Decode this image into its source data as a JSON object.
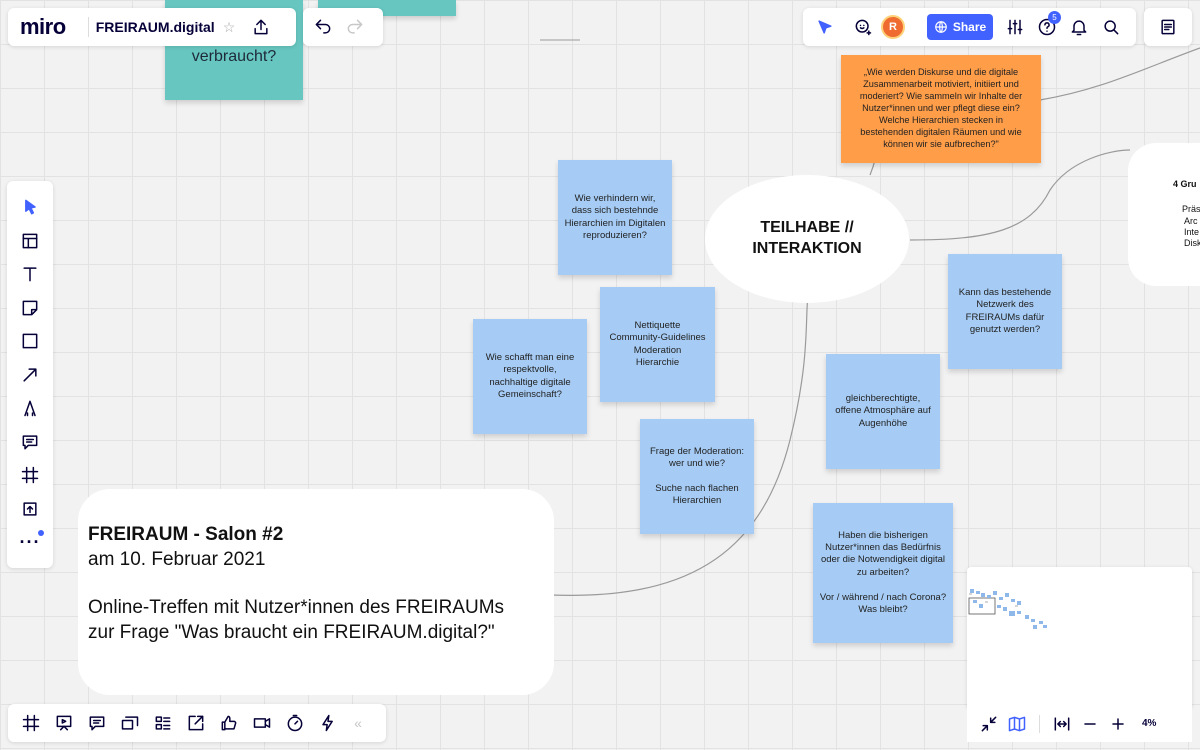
{
  "header": {
    "logo": "miro",
    "board_title": "FREIRAUM.digital",
    "share_label": "Share",
    "avatar_letter": "R",
    "help_badge": "5"
  },
  "stickies": {
    "teal_top": "verbraucht?",
    "orange": "„Wie werden Diskurse und die digitale Zusammenarbeit motiviert, initiiert und moderiert? Wie sammeln wir Inhalte der Nutzer*innen und wer  pflegt diese ein? Welche Hierarchien stecken in bestehenden  digitalen Räumen und wie können wir sie aufbrechen?\"",
    "hierarchien": "Wie verhindern wir, dass sich  bestehnde Hierarchien im Digitalen reproduzieren?",
    "netiquette": "Nettiquette\nCommunity-Guidelines\nModeration\nHierarchie",
    "gemeinschaft": "Wie schafft man eine respektvolle, nachhaltige digitale Gemeinschaft?",
    "moderation": "Frage der Moderation: wer und wie?\n\nSuche nach flachen Hierarchien",
    "netzwerk": "Kann das bestehende Netzwerk des FREIRAUMs dafür genutzt werden?",
    "atmosphaere": "gleichberechtigte, offene Atmosphäre auf Augenhöhe",
    "beduerfnis": "Haben die bisherigen Nutzer*innen das Bedürfnis oder die Notwendigkeit digital zu arbeiten?\n\nVor / während / nach Corona? Was bleibt?"
  },
  "ellipse": {
    "label": "TEILHABE //\nINTERAKTION"
  },
  "right_card": {
    "title": "4 Gru",
    "lines": [
      "Präs",
      "Arc",
      "Inte",
      "Disk"
    ]
  },
  "info_card": {
    "title": "FREIRAUM - Salon #2",
    "date": "am 10. Februar 2021",
    "line1": "Online-Treffen mit Nutzer*innen des FREIRAUMs",
    "line2": "zur Frage \"Was braucht ein FREIRAUM.digital?\""
  },
  "zoom": {
    "level": "4%"
  },
  "colors": {
    "accent": "#4262ff",
    "sticky_blue": "#a6ccf5",
    "sticky_orange": "#ff9d48",
    "sticky_teal": "#67c6c0",
    "avatar": "#ef6b30"
  },
  "icons": {
    "left_toolbar": [
      "select-cursor-icon",
      "templates-icon",
      "text-icon",
      "sticky-note-icon",
      "shape-icon",
      "arrow-icon",
      "pen-icon",
      "comment-icon",
      "frame-icon",
      "upload-icon",
      "more-icon"
    ],
    "bottom_toolbar": [
      "frames-icon",
      "presentation-icon",
      "comments-icon",
      "cards-icon",
      "kanban-icon",
      "share-screen-icon",
      "voting-icon",
      "video-icon",
      "timer-icon",
      "lightning-icon",
      "collapse-icon"
    ]
  }
}
